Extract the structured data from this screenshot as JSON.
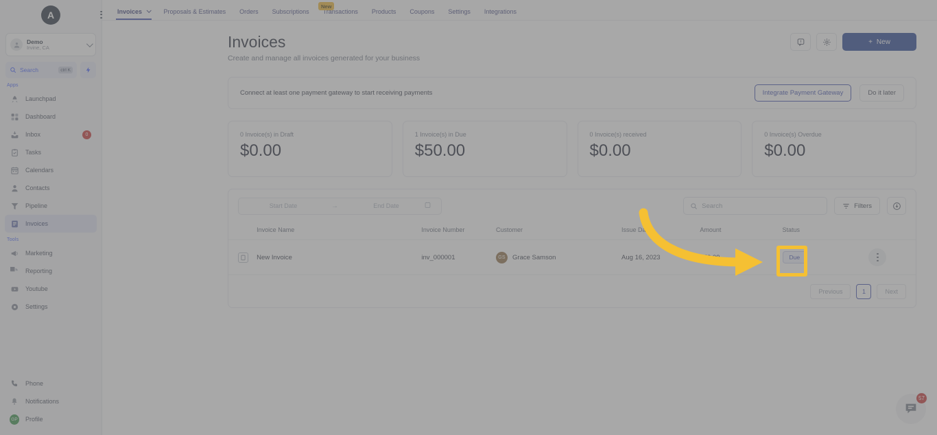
{
  "brand": {
    "logo_initial": "A",
    "accent": "#3949ab",
    "primary_button": "#1b3a8f",
    "highlight": "#f5c033"
  },
  "sidebar": {
    "account": {
      "name": "Demo",
      "location": "Irvine, CA"
    },
    "search": {
      "label": "Search",
      "shortcut": "ctrl K"
    },
    "groups": [
      {
        "label": "Apps",
        "items": [
          {
            "label": "Launchpad",
            "icon": "rocket-icon"
          },
          {
            "label": "Dashboard",
            "icon": "grid-icon"
          },
          {
            "label": "Inbox",
            "icon": "inbox-icon",
            "badge": "0"
          },
          {
            "label": "Tasks",
            "icon": "clipboard-check-icon"
          },
          {
            "label": "Calendars",
            "icon": "calendar-icon"
          },
          {
            "label": "Contacts",
            "icon": "user-icon"
          },
          {
            "label": "Pipeline",
            "icon": "funnel-icon"
          },
          {
            "label": "Invoices",
            "icon": "invoice-icon",
            "active": true
          }
        ]
      },
      {
        "label": "Tools",
        "items": [
          {
            "label": "Marketing",
            "icon": "megaphone-icon"
          },
          {
            "label": "Reporting",
            "icon": "pie-chart-icon"
          },
          {
            "label": "Youtube",
            "icon": "video-icon"
          },
          {
            "label": "Settings",
            "icon": "gear-icon"
          }
        ]
      }
    ],
    "bottom": [
      {
        "label": "Phone",
        "icon": "phone-icon"
      },
      {
        "label": "Notifications",
        "icon": "bell-icon"
      },
      {
        "label": "Profile",
        "icon": "avatar",
        "initials": "GP"
      }
    ]
  },
  "topnav": {
    "tabs": [
      {
        "label": "Invoices",
        "active": true,
        "has_caret": true
      },
      {
        "label": "Proposals & Estimates",
        "tag": "New"
      },
      {
        "label": "Orders"
      },
      {
        "label": "Subscriptions"
      },
      {
        "label": "Transactions"
      },
      {
        "label": "Products"
      },
      {
        "label": "Coupons"
      },
      {
        "label": "Settings"
      },
      {
        "label": "Integrations"
      }
    ],
    "tag_label": "New"
  },
  "header": {
    "title": "Invoices",
    "subtitle": "Create and manage all invoices generated for your business",
    "feedback_icon": "chat-feedback-icon",
    "settings_icon": "gear-icon",
    "new_button": "New",
    "new_button_icon": "plus-icon"
  },
  "banner": {
    "message": "Connect at least one payment gateway to start receiving payments",
    "primary_action": "Integrate Payment Gateway",
    "secondary_action": "Do it later"
  },
  "stats": [
    {
      "label": "0 Invoice(s) in Draft",
      "value": "$0.00"
    },
    {
      "label": "1 Invoice(s) in Due",
      "value": "$50.00"
    },
    {
      "label": "0 Invoice(s) received",
      "value": "$0.00"
    },
    {
      "label": "0 Invoice(s) Overdue",
      "value": "$0.00"
    }
  ],
  "toolbar": {
    "start_date_placeholder": "Start Date",
    "range_arrow": "→",
    "end_date_placeholder": "End Date",
    "calendar_icon": "calendar-icon",
    "search_placeholder": "Search",
    "search_icon": "search-icon",
    "filters_label": "Filters",
    "filters_icon": "filter-icon",
    "download_icon": "download-icon"
  },
  "table": {
    "columns": [
      "Invoice Name",
      "Invoice Number",
      "Customer",
      "Issue Date",
      "Amount",
      "Status"
    ],
    "rows": [
      {
        "name": "New Invoice",
        "number": "inv_000001",
        "customer": "Grace Samson",
        "customer_initials": "GS",
        "issue_date": "Aug 16, 2023",
        "amount": "$50.00",
        "status": "Due",
        "row_icon": "document-icon",
        "action_icon": "kebab-menu-icon"
      }
    ]
  },
  "pagination": {
    "previous": "Previous",
    "current_page": "1",
    "next": "Next"
  },
  "chat": {
    "badge": "57",
    "icon": "chat-bubble-icon"
  }
}
